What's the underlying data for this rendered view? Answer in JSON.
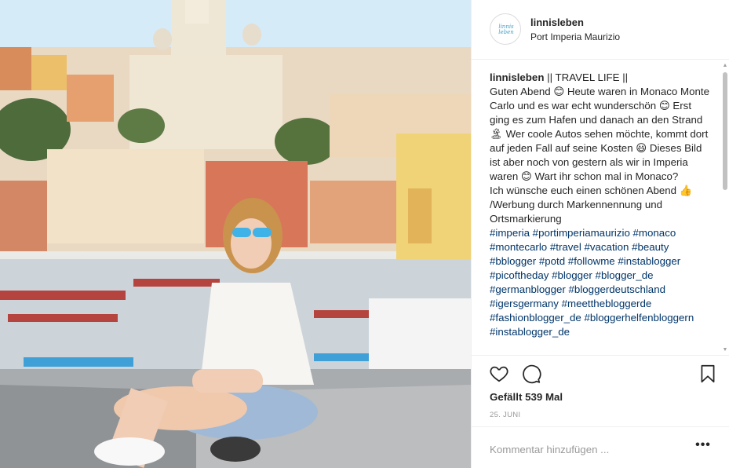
{
  "post": {
    "photo_description": "",
    "header": {
      "username": "linnisleben",
      "location": "Port Imperia Maurizio",
      "avatar_logo_text": "linnis leben"
    },
    "caption": {
      "username": "linnisleben",
      "title": " || TRAVEL LIFE ||",
      "line1": "Guten Abend 😊 Heute waren in Monaco Monte Carlo und es war echt wunderschön 😊 Erst ging es zum Hafen und danach an den Strand 🏝 Wer coole Autos sehen möchte, kommt dort auf jeden Fall auf seine Kosten 😃 Dieses Bild ist aber noch von gestern als wir in Imperia waren 😊 Wart ihr schon mal in Monaco?",
      "line2": "Ich wünsche euch einen schönen Abend 👍 /Werbung durch Markennennung und Ortsmarkierung",
      "hashtags": "#imperia #portimperiamaurizio #monaco #montecarlo #travel #vacation #beauty #bblogger #potd #followme #instablogger #picoftheday #blogger #blogger_de #germanblogger #bloggerdeutschland #igersgermany #meetthebloggerde #fashionblogger_de #bloggerhelfenbloggern #instablogger_de"
    },
    "actions": {
      "like_icon": "heart-outline-icon",
      "comment_icon": "speech-bubble-icon",
      "save_icon": "bookmark-icon"
    },
    "likes_text": "Gefällt 539 Mal",
    "date": "25. JUNI",
    "comment": {
      "placeholder": "Kommentar hinzufügen ...",
      "value": "",
      "more_label": "•••"
    },
    "colors": {
      "hashtag": "#003569",
      "text": "#262626",
      "muted": "#999999",
      "border": "#efefef"
    }
  }
}
